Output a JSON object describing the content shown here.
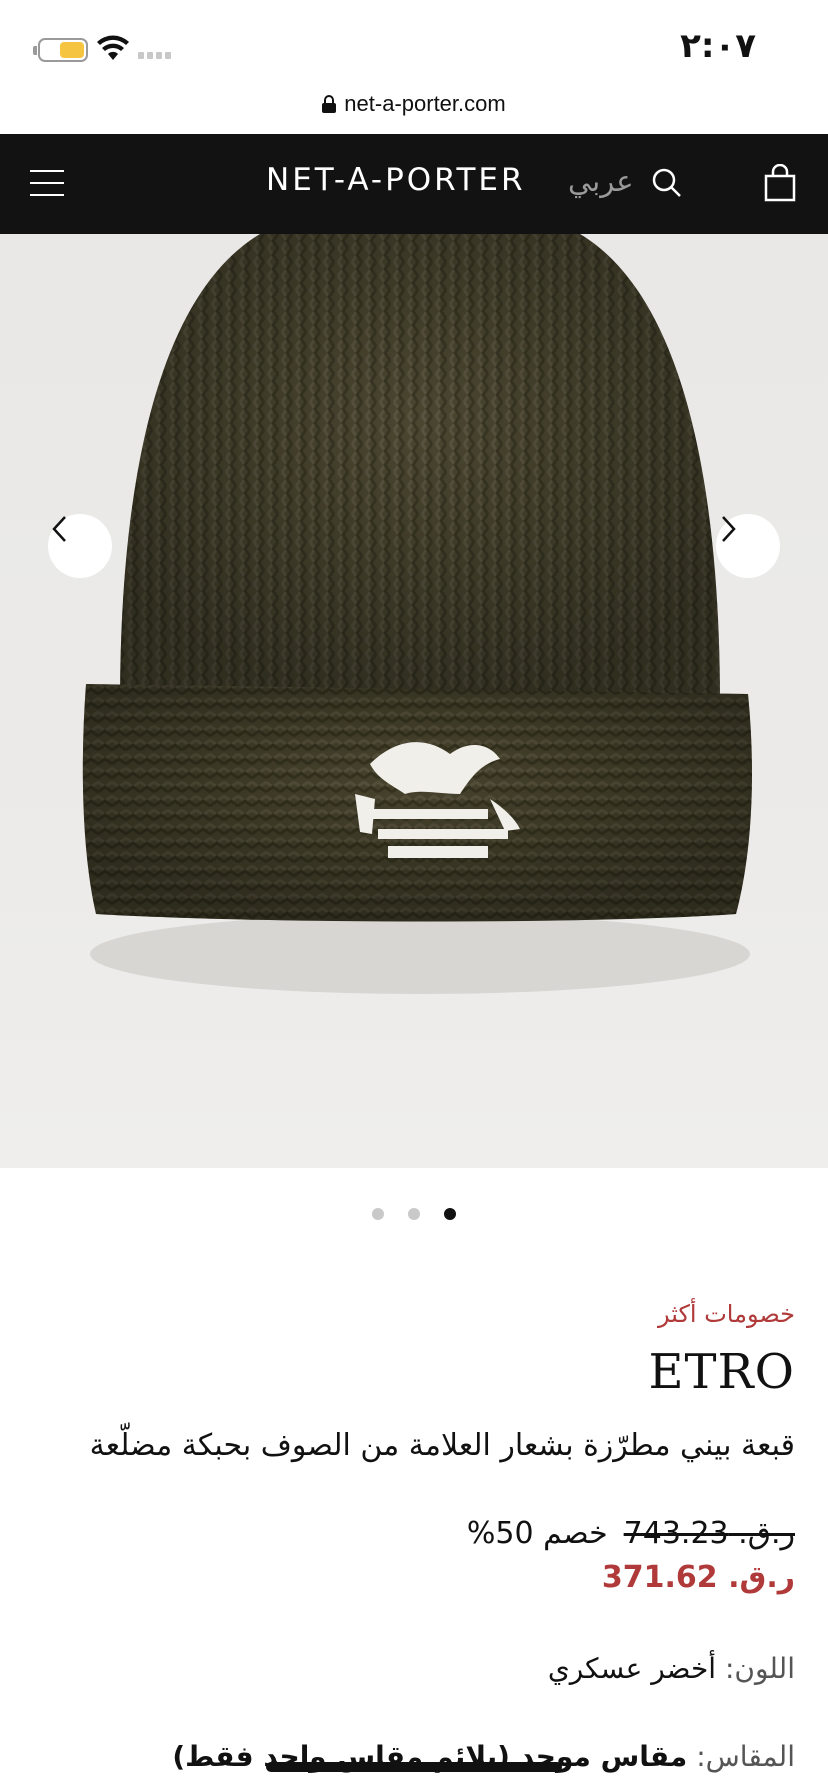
{
  "status_bar": {
    "time": "٢:٠٧",
    "battery_icon": "battery-icon",
    "wifi_icon": "wifi-icon",
    "signal_icon": "cellular-signal-icon",
    "battery_color": "#f5c542"
  },
  "browser": {
    "url": "net-a-porter.com",
    "lock_icon": "lock-icon"
  },
  "header": {
    "logo": "NET-A-PORTER",
    "language": "عربي",
    "menu_icon": "hamburger-menu-icon",
    "search_icon": "search-icon",
    "bag_icon": "shopping-bag-icon",
    "background": "#121212"
  },
  "gallery": {
    "image_alt": "knit-beanie-image",
    "prev_icon": "chevron-left-icon",
    "next_icon": "chevron-right-icon",
    "dots_count": 3,
    "active_dot": 2
  },
  "product": {
    "promo_label": "خصومات أكثر",
    "brand": "ETRO",
    "title": "قبعة بيني مطرّزة بشعار العلامة من الصوف بحبكة مضلّعة",
    "old_price": "ر.ق. 743.23",
    "discount": "خصم 50%",
    "new_price": "ر.ق. 371.62",
    "color_label": "اللون:",
    "color_value": "أخضر عسكري",
    "size_label": "المقاس:",
    "size_value": "مقاس موحد (يلائم مقاس واحد فقط)",
    "accent_color": "#b03a3a"
  }
}
